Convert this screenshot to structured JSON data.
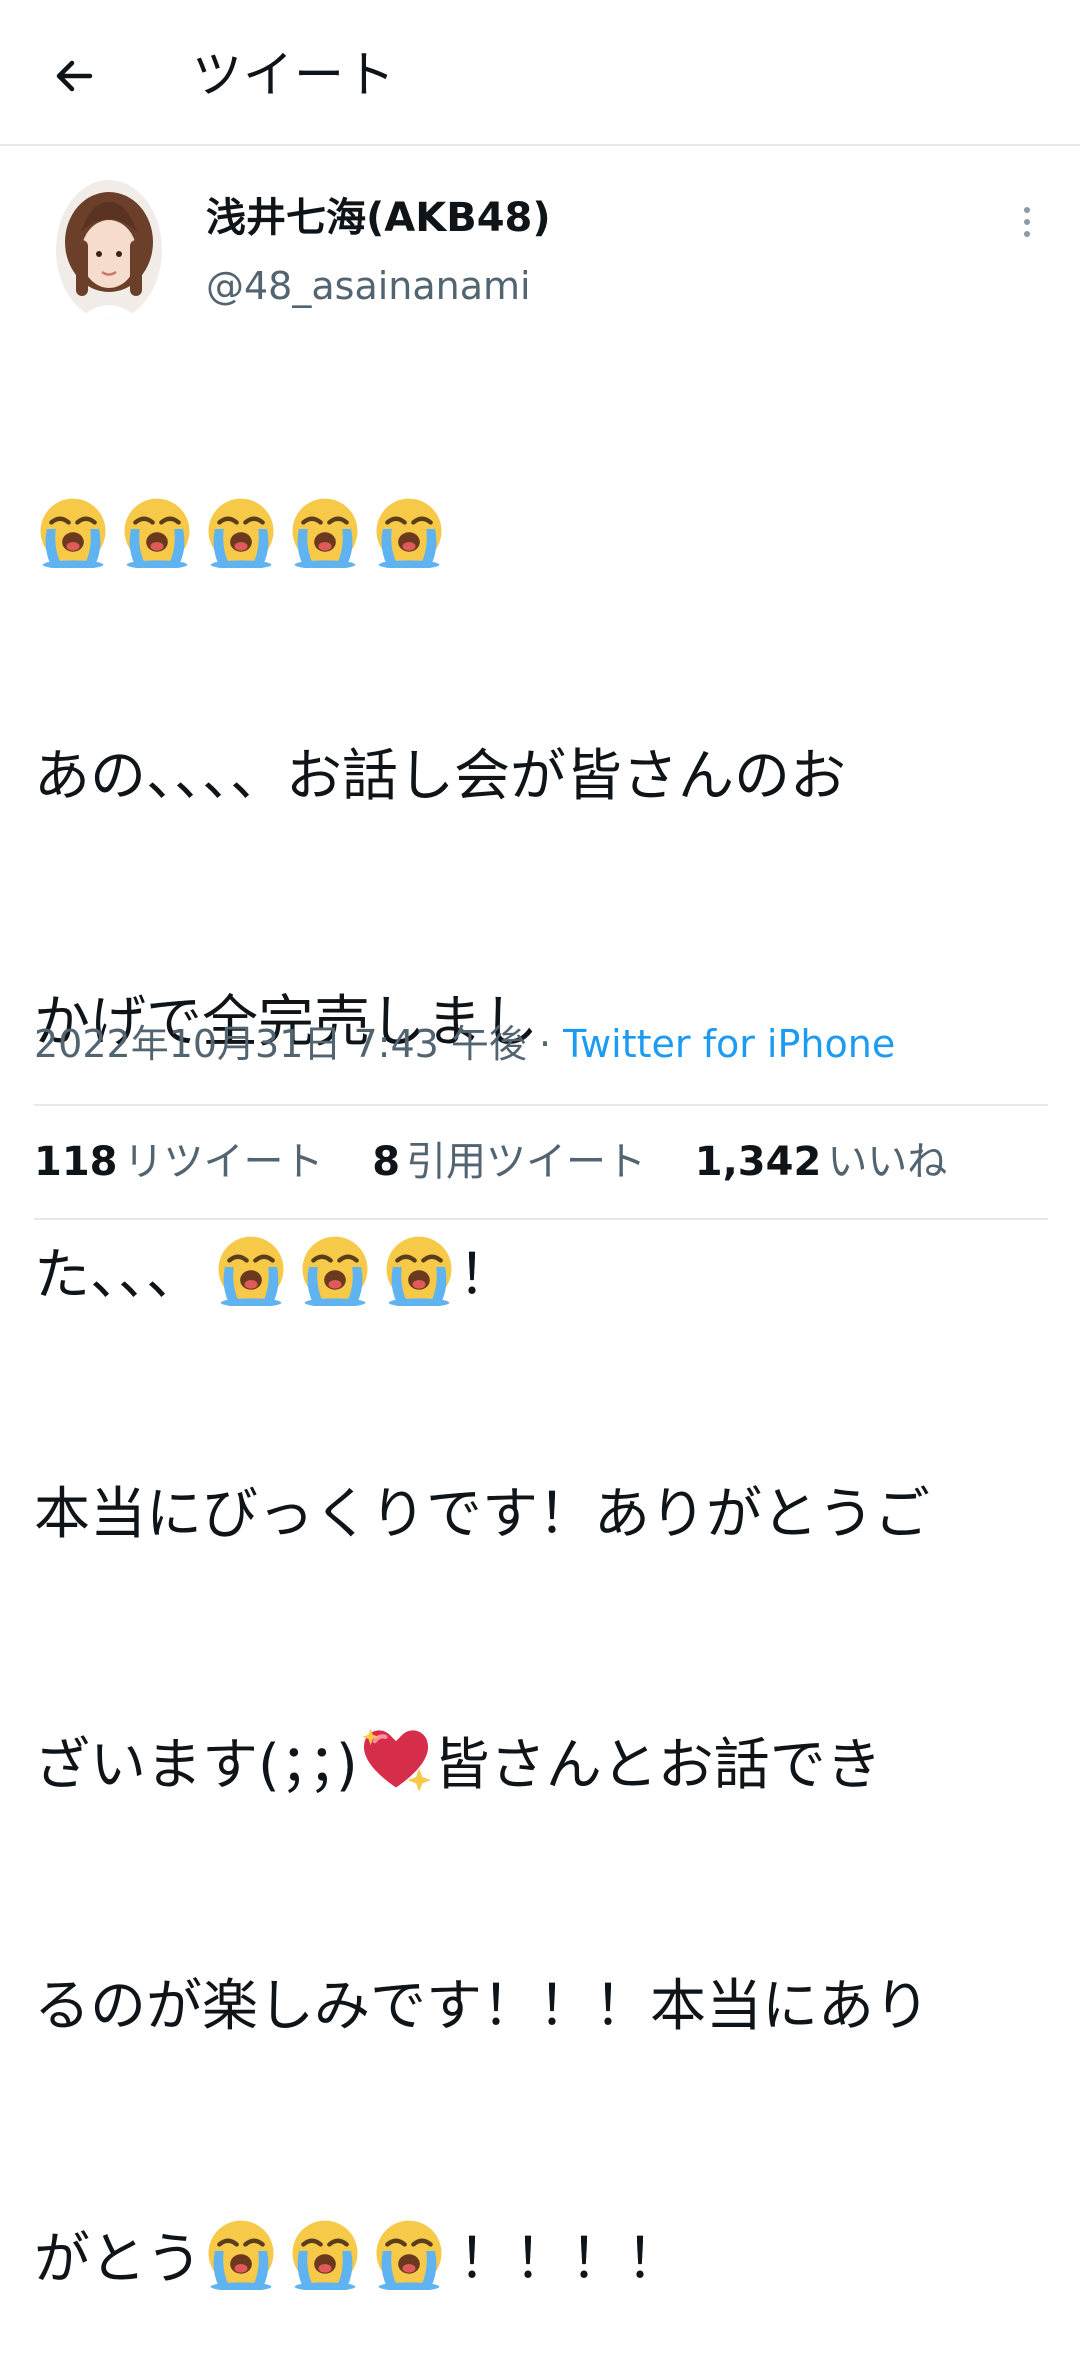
{
  "header": {
    "title": "ツイート",
    "back_icon": "arrow-left-icon"
  },
  "author": {
    "display_name": "浅井七海(AKB48)",
    "handle": "@48_asainanami",
    "more_icon": "more-vertical-icon"
  },
  "tweet": {
    "emoji_line_count": 5,
    "line2": "あの、、、、お話し会が皆さんのお",
    "line3": "かげで全完売しまし",
    "line4_text": "た、、、",
    "line4_end": "！",
    "line5": "本当にびっくりです！ありがとうご",
    "line6_start": "ざいます(；；)",
    "line6_end": "皆さんとお話でき",
    "line7": "るのが楽しみです！！！本当にあり",
    "line8_start": "がとう",
    "line8_end": "！！！！"
  },
  "meta": {
    "timestamp": "2022年10月31日 7:43 午後",
    "separator": " · ",
    "source": "Twitter for iPhone"
  },
  "stats": {
    "retweets_count": "118",
    "retweets_label": "リツイート",
    "quotes_count": "8",
    "quotes_label": "引用ツイート",
    "likes_count": "1,342",
    "likes_label": "いいね"
  },
  "colors": {
    "text": "#0f1419",
    "secondary": "#536471",
    "link": "#1d9bf0",
    "divider": "#e6e9ec"
  }
}
